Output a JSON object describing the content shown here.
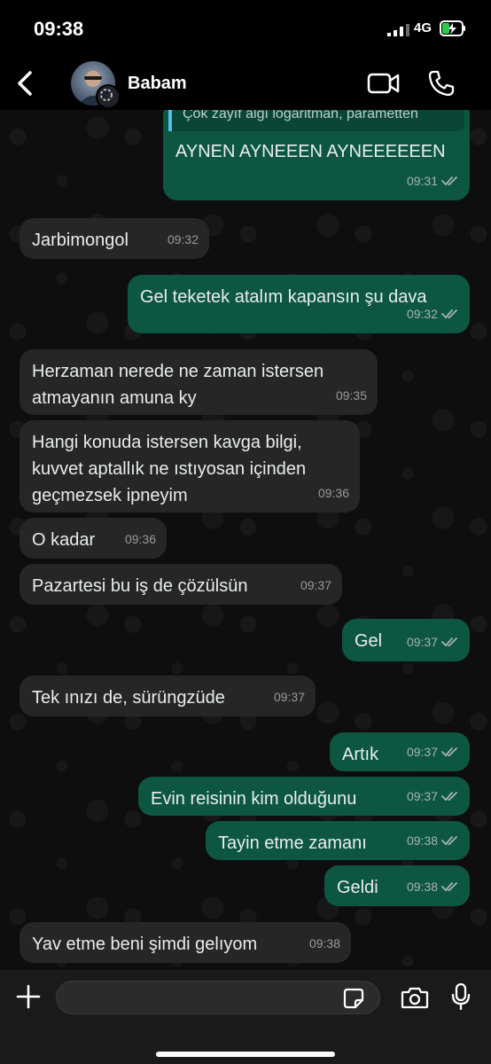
{
  "status": {
    "time": "09:38",
    "network": "4G"
  },
  "header": {
    "contact_name": "Babam"
  },
  "quote": {
    "text": "Çok zayıf algı logaritman, parametten"
  },
  "messages": [
    {
      "dir": "out",
      "text": "AYNEN AYNEEEN AYNEEEEEEN",
      "time": "09:31"
    },
    {
      "dir": "in",
      "text": "Jarbimongol",
      "time": "09:32"
    },
    {
      "dir": "out",
      "text": "Gel teketek atalım kapansın şu dava",
      "time": "09:32"
    },
    {
      "dir": "in",
      "text": "Herzaman nerede ne zaman istersen\natmayanın amuna ky",
      "time": "09:35"
    },
    {
      "dir": "in",
      "text": "Hangi konuda istersen kavga bilgi,\nkuvvet aptallık ne ıstıyosan içinden\ngeçmezsek ipneyim",
      "time": "09:36"
    },
    {
      "dir": "in",
      "text": "O kadar",
      "time": "09:36"
    },
    {
      "dir": "in",
      "text": "Pazartesi bu iş de çözülsün",
      "time": "09:37"
    },
    {
      "dir": "out",
      "text": "Gel",
      "time": "09:37"
    },
    {
      "dir": "in",
      "text": "Tek ınızı de, sürüngzüde",
      "time": "09:37"
    },
    {
      "dir": "out",
      "text": "Artık",
      "time": "09:37"
    },
    {
      "dir": "out",
      "text": "Evin reisinin kim olduğunu",
      "time": "09:37"
    },
    {
      "dir": "out",
      "text": "Tayin etme zamanı",
      "time": "09:38"
    },
    {
      "dir": "out",
      "text": "Geldi",
      "time": "09:38"
    },
    {
      "dir": "in",
      "text": "Yav etme beni şimdi gelıyom",
      "time": "09:38"
    }
  ],
  "composer": {
    "placeholder": ""
  }
}
